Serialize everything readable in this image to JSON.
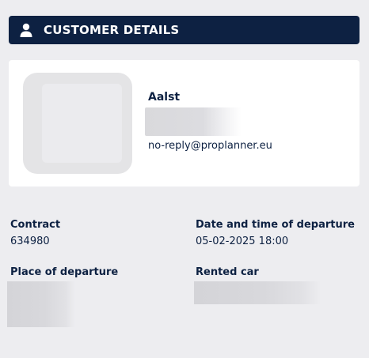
{
  "header": {
    "title": "CUSTOMER DETAILS",
    "icon": "person-icon"
  },
  "customer": {
    "name": "Aalst",
    "email": "no-reply@proplanner.eu"
  },
  "details": {
    "contract_label": "Contract",
    "contract_value": "634980",
    "departure_time_label": "Date and time of departure",
    "departure_time_value": "05-02-2025 18:00",
    "place_label": "Place of departure",
    "rented_car_label": "Rented car"
  },
  "colors": {
    "header_bg": "#0d2142",
    "page_bg": "#ededf0",
    "card_bg": "#ffffff",
    "text": "#0d2142"
  }
}
